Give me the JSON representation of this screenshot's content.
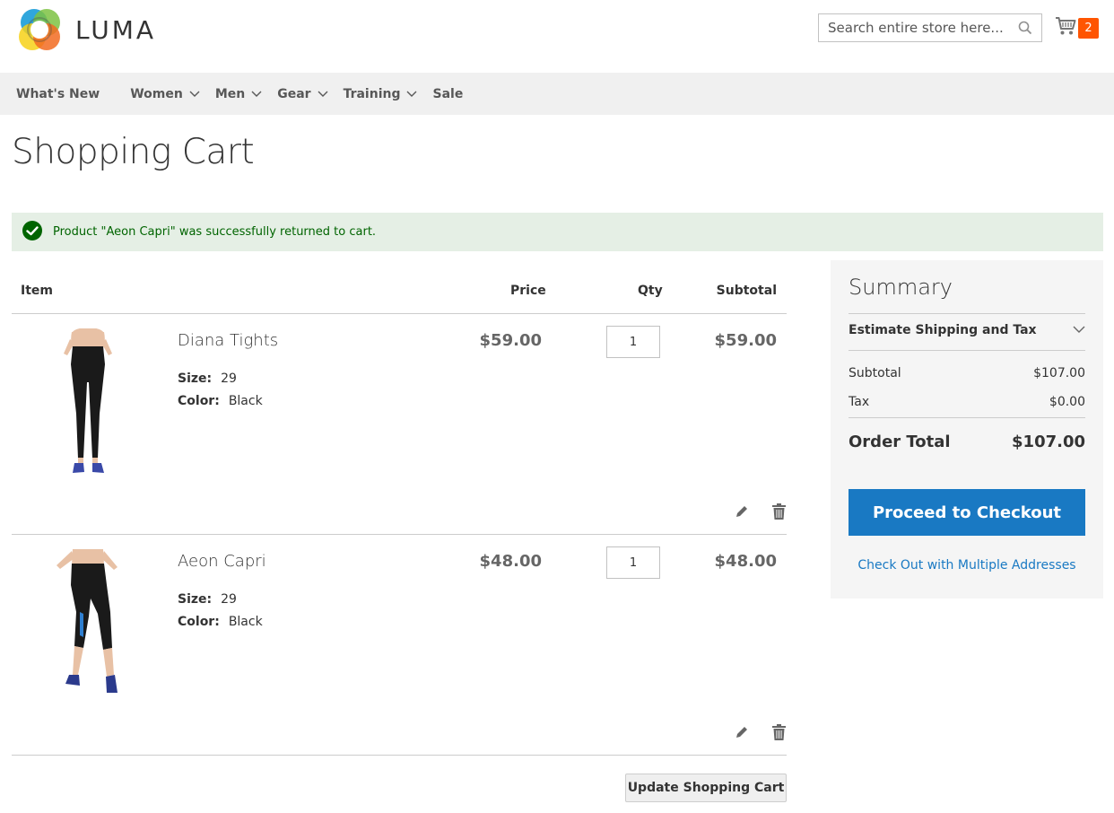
{
  "header": {
    "logo_text": "LUMA",
    "search_placeholder": "Search entire store here...",
    "cart_count": "2"
  },
  "nav": [
    {
      "label": "What's New",
      "has_dropdown": false
    },
    {
      "label": "Women",
      "has_dropdown": true
    },
    {
      "label": "Men",
      "has_dropdown": true
    },
    {
      "label": "Gear",
      "has_dropdown": true
    },
    {
      "label": "Training",
      "has_dropdown": true
    },
    {
      "label": "Sale",
      "has_dropdown": false
    }
  ],
  "page_title": "Shopping Cart",
  "message": "Product \"Aeon Capri\" was successfully returned to cart.",
  "table": {
    "col_item": "Item",
    "col_price": "Price",
    "col_qty": "Qty",
    "col_subtotal": "Subtotal"
  },
  "items": [
    {
      "name": "Diana Tights",
      "size_label": "Size:",
      "size": "29",
      "color_label": "Color:",
      "color": "Black",
      "price": "$59.00",
      "qty": "1",
      "subtotal": "$59.00"
    },
    {
      "name": "Aeon Capri",
      "size_label": "Size:",
      "size": "29",
      "color_label": "Color:",
      "color": "Black",
      "price": "$48.00",
      "qty": "1",
      "subtotal": "$48.00"
    }
  ],
  "update_button": "Update Shopping Cart",
  "summary": {
    "title": "Summary",
    "estimate": "Estimate Shipping and Tax",
    "subtotal_label": "Subtotal",
    "subtotal": "$107.00",
    "tax_label": "Tax",
    "tax": "$0.00",
    "total_label": "Order Total",
    "total": "$107.00",
    "checkout_button": "Proceed to Checkout",
    "multi_link": "Check Out with Multiple Addresses"
  },
  "colors": {
    "accent": "#1979c3",
    "cart_badge": "#ff5501",
    "success_bg": "#e5efe5",
    "success_text": "#006400"
  }
}
